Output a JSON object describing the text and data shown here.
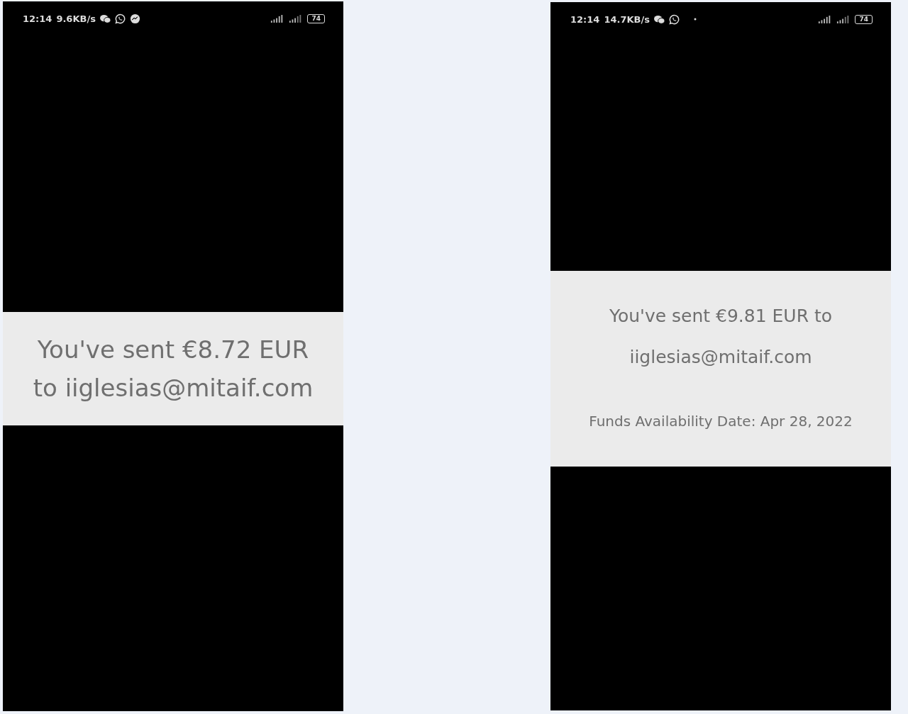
{
  "phones": [
    {
      "status_bar": {
        "time": "12:14",
        "speed": "9.6KB/s",
        "notification_icons": [
          {
            "kind": "double-bubble"
          },
          {
            "kind": "phone-bubble"
          },
          {
            "kind": "lightning-bubble"
          }
        ],
        "battery": "74"
      },
      "message": {
        "lines": [
          "You've sent €8.72 EUR",
          "to iiglesias@mitaif.com"
        ]
      }
    },
    {
      "status_bar": {
        "time": "12:14",
        "speed": "14.7KB/s",
        "notification_icons": [
          {
            "kind": "double-bubble"
          },
          {
            "kind": "phone-bubble"
          },
          {
            "kind": "dot"
          }
        ],
        "battery": "74"
      },
      "message": {
        "lines": [
          "You've sent €9.81 EUR to",
          "iiglesias@mitaif.com"
        ],
        "note": "Funds Availability Date: Apr 28, 2022"
      }
    }
  ]
}
